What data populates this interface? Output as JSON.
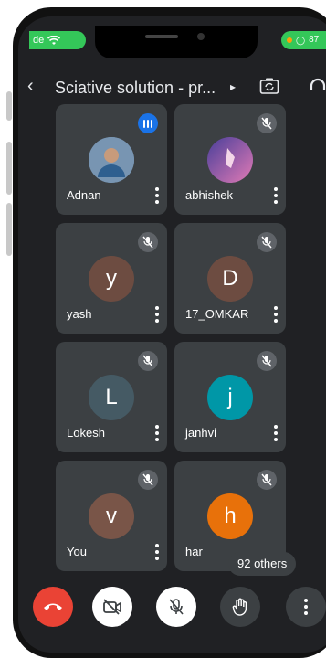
{
  "status_bar": {
    "left_text": "de",
    "battery_text": "87"
  },
  "header": {
    "back_glyph": "‹",
    "title": "Sciative solution - pr...",
    "chevron_glyph": "▸"
  },
  "participants": [
    {
      "name": "Adnan",
      "initial": "",
      "avatar_color": "#6b8aa8",
      "status": "speaking"
    },
    {
      "name": "abhishek",
      "initial": "",
      "avatar_color": "#8a6ab0",
      "status": "muted"
    },
    {
      "name": "yash",
      "initial": "y",
      "avatar_color": "#6d4c41",
      "status": "muted"
    },
    {
      "name": "17_OMKAR",
      "initial": "D",
      "avatar_color": "#6d4c41",
      "status": "muted"
    },
    {
      "name": "Lokesh",
      "initial": "L",
      "avatar_color": "#455a64",
      "status": "muted"
    },
    {
      "name": "janhvi",
      "initial": "j",
      "avatar_color": "#0097a7",
      "status": "muted"
    },
    {
      "name": "You",
      "initial": "v",
      "avatar_color": "#795548",
      "status": "muted"
    },
    {
      "name": "har",
      "initial": "h",
      "avatar_color": "#e8710a",
      "status": "muted"
    }
  ],
  "others_label": "92 others",
  "controls": {
    "end_call_color": "#ea4335",
    "video_icon": "video-off-icon",
    "mic_icon": "mic-off-icon",
    "hand_icon": "raise-hand-icon",
    "more_icon": "more-options-icon"
  }
}
